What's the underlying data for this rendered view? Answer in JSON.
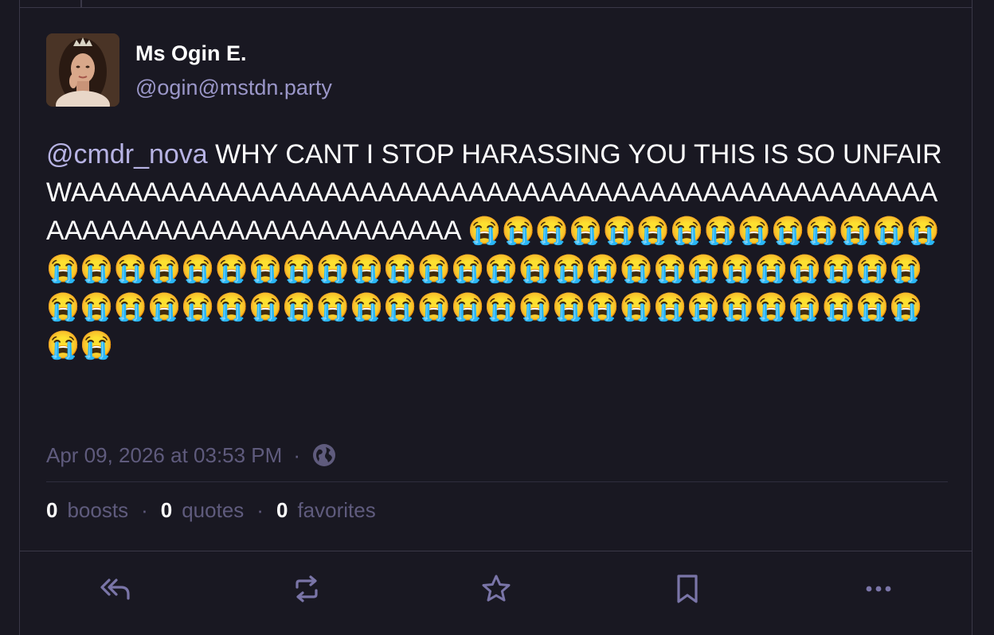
{
  "author": {
    "display_name": "Ms Ogin E.",
    "handle": "@ogin@mstdn.party"
  },
  "post": {
    "mention": "@cmdr_nova",
    "text": " WHY CANT I STOP HARASSING YOU THIS IS SO UNFAIR WAAAAAAAAAAAAAAAAAAAAAAAAAAAAAAAAAAAAAAAAAAAAAAAAAAAAAAAAAAAAAAAAAAAAAAA ",
    "emojis": "😭😭😭😭😭😭😭😭😭😭😭😭😭😭😭😭😭😭😭😭😭😭😭😭😭😭😭😭😭😭😭😭😭😭😭😭😭😭😭😭😭😭😭😭😭😭😭😭😭😭😭😭😭😭😭😭😭😭😭😭😭😭😭😭😭😭😭😭"
  },
  "meta": {
    "timestamp": "Apr 09, 2026 at 03:53 PM",
    "separator": "·",
    "visibility_icon": "globe-icon"
  },
  "stats": {
    "boosts_count": "0",
    "boosts_label": "boosts",
    "quotes_count": "0",
    "quotes_label": "quotes",
    "favorites_count": "0",
    "favorites_label": "favorites",
    "separator": "·"
  },
  "actions": [
    {
      "icon": "reply-all-icon"
    },
    {
      "icon": "boost-icon"
    },
    {
      "icon": "star-icon"
    },
    {
      "icon": "bookmark-icon"
    },
    {
      "icon": "more-icon"
    }
  ],
  "colors": {
    "background": "#191822",
    "text": "#ffffff",
    "mention": "#b7b3e4",
    "handle": "#9b97c9",
    "muted": "#5f5b7d",
    "icon": "#7a75a8"
  }
}
